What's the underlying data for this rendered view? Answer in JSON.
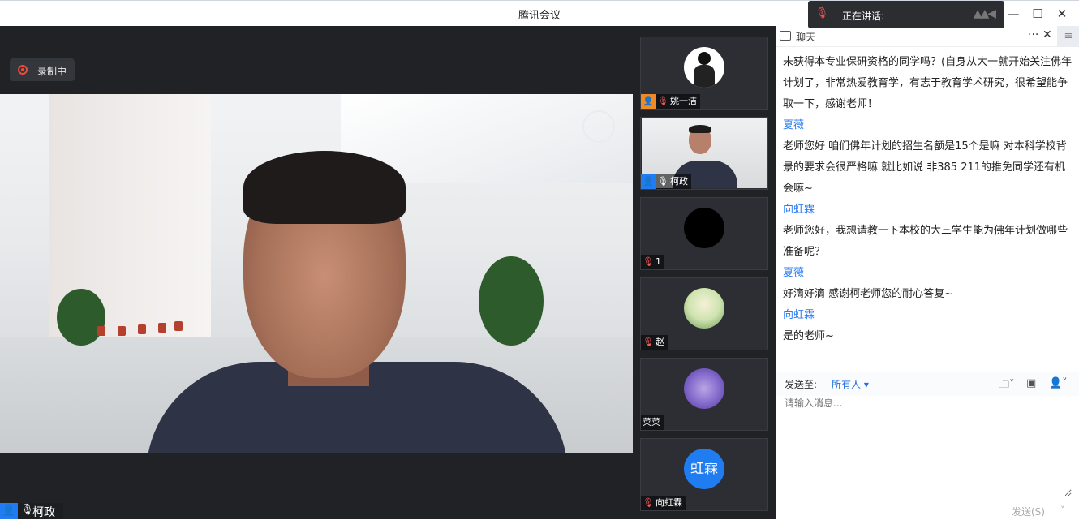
{
  "window": {
    "title": "腾讯会议"
  },
  "speaking_bar": {
    "label": "正在讲话:"
  },
  "stage": {
    "recording_label": "录制中",
    "speaker_name": "柯政"
  },
  "participants": [
    {
      "name": "姚一洁",
      "host": true,
      "muted": true
    },
    {
      "name": "柯政",
      "host": true,
      "muted": false,
      "video": true
    },
    {
      "name": "1",
      "host": false,
      "muted": true
    },
    {
      "name": "赵",
      "host": false,
      "muted": true
    },
    {
      "name": "菜菜",
      "host": false,
      "muted": false
    },
    {
      "name": "向虹霖",
      "host": false,
      "muted": true,
      "avatar_text": "虹霖"
    }
  ],
  "chat": {
    "title": "聊天",
    "messages": [
      {
        "sender": "",
        "text": "未获得本专业保研资格的同学吗？(自身从大一就开始关注佛年计划了，非常热爱教育学，有志于教育学术研究，很希望能争取一下，感谢老师！"
      },
      {
        "sender": "夏薇",
        "text": "老师您好 咱们佛年计划的招生名额是15个是嘛 对本科学校背景的要求会很严格嘛 就比如说 非385 211的推免同学还有机会嘛~"
      },
      {
        "sender": "向虹霖",
        "text": "老师您好，我想请教一下本校的大三学生能为佛年计划做哪些准备呢？"
      },
      {
        "sender": "夏薇",
        "text": "好滴好滴 感谢柯老师您的耐心答复~"
      },
      {
        "sender": "向虹霖",
        "text": "是的老师~"
      }
    ],
    "send_to_label": "发送至:",
    "send_to_value": "所有人",
    "input_placeholder": "请输入消息...",
    "send_button": "发送(S)"
  },
  "colors": {
    "accent": "#2f7cf0",
    "dark_bg": "#202226",
    "avatar_blue": "#1f7cf1"
  }
}
